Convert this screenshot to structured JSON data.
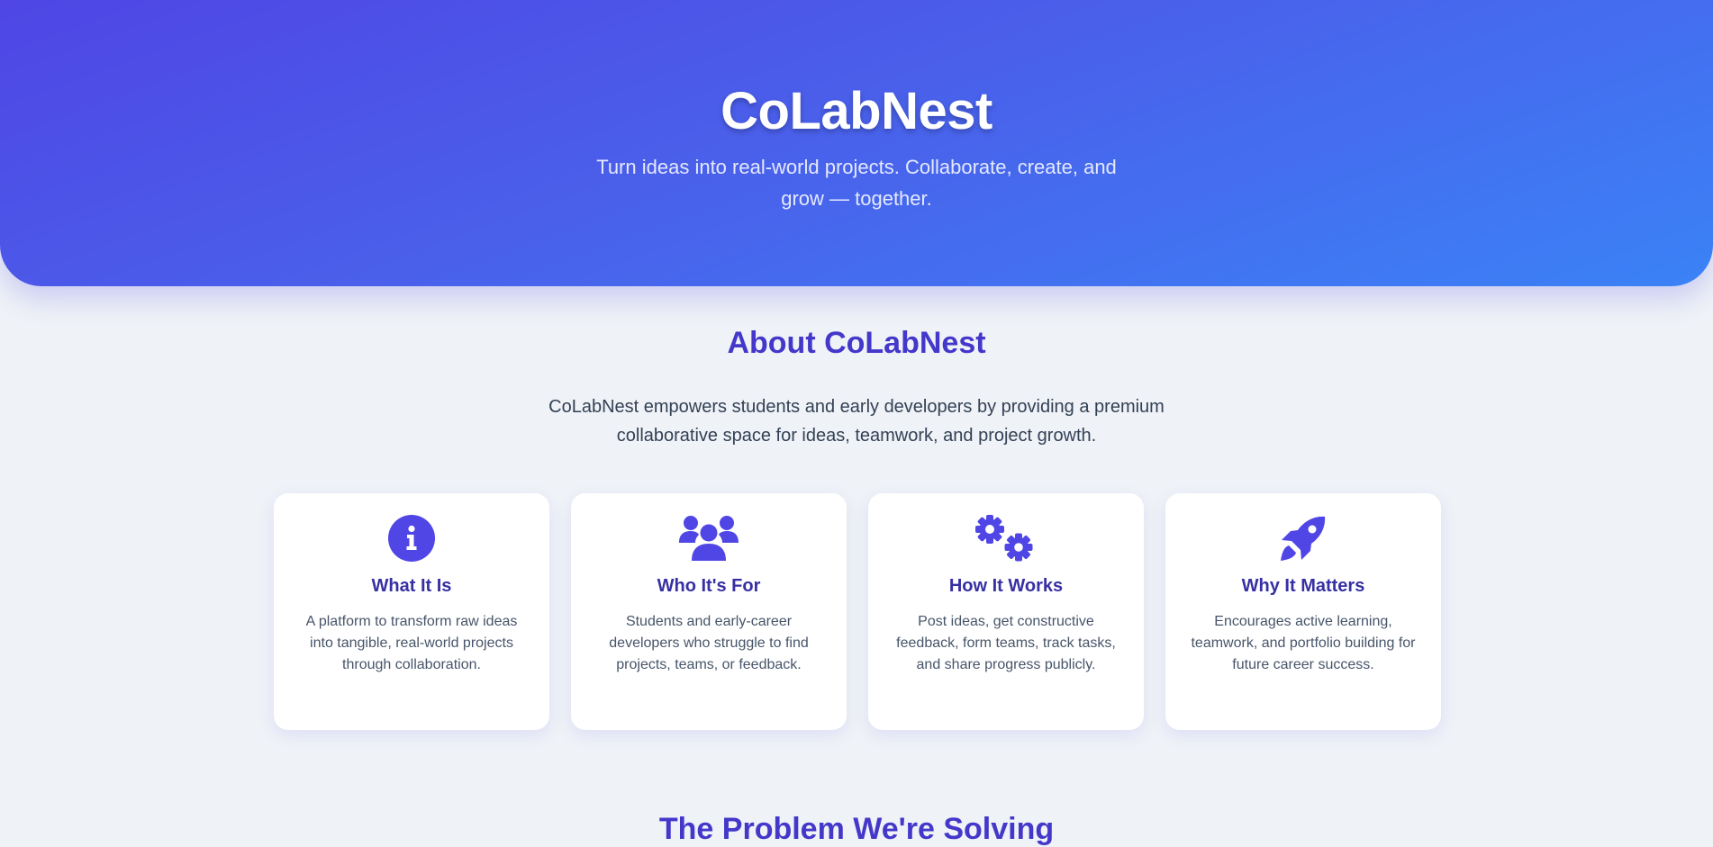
{
  "hero": {
    "title": "CoLabNest",
    "subtitle": "Turn ideas into real-world projects. Collaborate, create, and grow — together."
  },
  "about": {
    "title": "About CoLabNest",
    "text": "CoLabNest empowers students and early developers by providing a premium collaborative space for ideas, teamwork, and project growth."
  },
  "cards": [
    {
      "icon": "info-icon",
      "title": "What It Is",
      "text": "A platform to transform raw ideas into tangible, real-world projects through collaboration."
    },
    {
      "icon": "users-icon",
      "title": "Who It's For",
      "text": "Students and early-career developers who struggle to find projects, teams, or feedback."
    },
    {
      "icon": "gears-icon",
      "title": "How It Works",
      "text": "Post ideas, get constructive feedback, form teams, track tasks, and share progress publicly."
    },
    {
      "icon": "rocket-icon",
      "title": "Why It Matters",
      "text": "Encourages active learning, teamwork, and portfolio building for future career success."
    }
  ],
  "next_section": {
    "title": "The Problem We're Solving"
  },
  "colors": {
    "accent": "#4f46e5",
    "heading": "#4338ca",
    "card_title": "#3730a3",
    "gradient_end": "#3b82f6",
    "page_bg": "#eff2f7"
  }
}
